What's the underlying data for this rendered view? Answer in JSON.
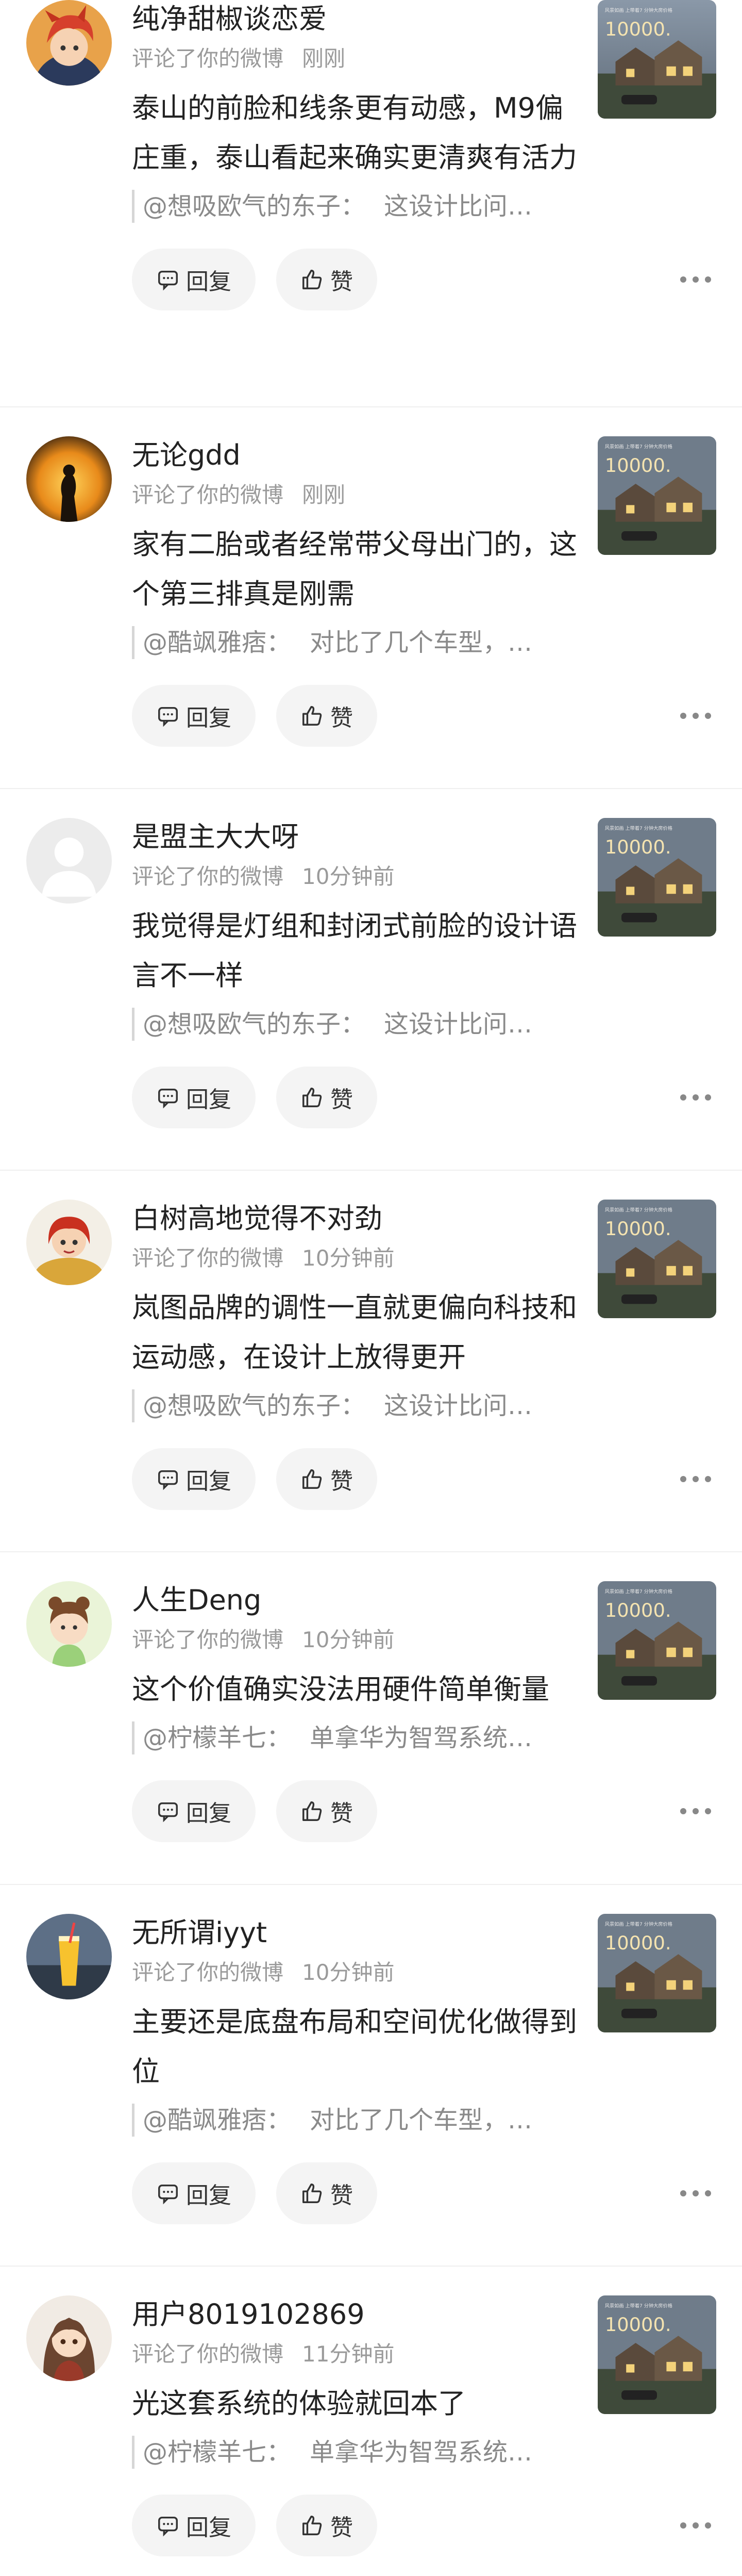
{
  "notifications": [
    {
      "user": "纯净甜椒谈恋爱",
      "action": "评论了你的微博",
      "time": "刚刚",
      "comment": "泰山的前脸和线条更有动感，M9偏庄重，泰山看起来确实更清爽有活力",
      "quote_user": "@想吸欧气的东子：",
      "quote_text": "这设计比问…",
      "avatar_icon": "anime-boy-red-hair-avatar"
    },
    {
      "user": "无论gdd",
      "action": "评论了你的微博",
      "time": "刚刚",
      "comment": "家有二胎或者经常带父母出门的，这个第三排真是刚需",
      "quote_user": "@酷飒雅痞：",
      "quote_text": "对比了几个车型，…",
      "avatar_icon": "sunset-silhouette-avatar"
    },
    {
      "user": "是盟主大大呀",
      "action": "评论了你的微博",
      "time": "10分钟前",
      "comment": "我觉得是灯组和封闭式前脸的设计语言不一样",
      "quote_user": "@想吸欧气的东子：",
      "quote_text": "这设计比问…",
      "avatar_icon": "default-user-avatar"
    },
    {
      "user": "白树高地觉得不对劲",
      "action": "评论了你的微博",
      "time": "10分钟前",
      "comment": "岚图品牌的调性一直就更偏向科技和运动感，在设计上放得更开",
      "quote_user": "@想吸欧气的东子：",
      "quote_text": "这设计比问…",
      "avatar_icon": "red-hair-girl-gold-avatar"
    },
    {
      "user": "人生Deng",
      "action": "评论了你的微博",
      "time": "10分钟前",
      "comment": "这个价值确实没法用硬件简单衡量",
      "quote_user": "@柠檬羊七：",
      "quote_text": "单拿华为智驾系统…",
      "avatar_icon": "cartoon-girl-avatar"
    },
    {
      "user": "无所谓iyyt",
      "action": "评论了你的微博",
      "time": "10分钟前",
      "comment": "主要还是底盘布局和空间优化做得到位",
      "quote_user": "@酷飒雅痞：",
      "quote_text": "对比了几个车型，…",
      "avatar_icon": "juice-drink-avatar"
    },
    {
      "user": "用户8019102869",
      "action": "评论了你的微博",
      "time": "11分钟前",
      "comment": "光这套系统的体验就回本了",
      "quote_user": "@柠檬羊七：",
      "quote_text": "单拿华为智驾系统…",
      "avatar_icon": "anime-girl-brown-hair-avatar"
    }
  ],
  "thumbnail": {
    "number": "10000.",
    "caption": "风景如画 上带着7 分钟大房价格",
    "icon": "house-promo-thumbnail"
  },
  "labels": {
    "reply": "回复",
    "like": "赞"
  },
  "colors": {
    "background": "#ffffff",
    "muted_text": "#9a9a9a",
    "button_bg": "#f4f4f4",
    "divider": "#efefef"
  }
}
